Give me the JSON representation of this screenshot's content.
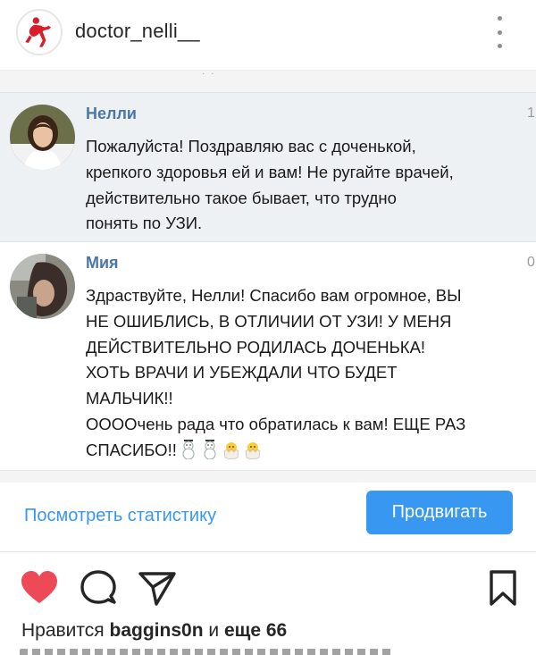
{
  "header": {
    "username": "doctor_nelli__",
    "avatar_icon": "red-figure-logo-icon",
    "more_icon": "more-vertical-icon"
  },
  "screenshot": {
    "comments": [
      {
        "author": "Нелли",
        "text": "Пожалуйста! Поздравляю вас с доченькой,\nкрепкого здоровья ей и вам! Не ругайте врачей,\nдействительно такое бывает, что трудно\nпонять по УЗИ.",
        "side": "1"
      },
      {
        "author": "Мия",
        "text": "Здраствуйте, Нелли! Спасибо вам огромное, ВЫ\nНЕ ОШИБЛИСЬ, В ОТЛИЧИИ ОТ УЗИ! У МЕНЯ\nДЕЙСТВИТЕЛЬНО РОДИЛАСЬ ДОЧЕНЬКА!\nХОТЬ ВРАЧИ И УБЕЖДАЛИ ЧТО БУДЕТ\nМАЛЬЧИК!!\nООООчень рада что обратилась к вам! ЕЩЕ РАЗ\nСПАСИБО!!",
        "emojis": [
          "snowman-icon",
          "snowman-icon",
          "hatching-chick-icon",
          "hatching-chick-icon"
        ],
        "side": "0"
      }
    ]
  },
  "promo": {
    "stats_label": "Посмотреть статистику",
    "promote_label": "Продвигать"
  },
  "actions": {
    "like_icon": "heart-filled-icon",
    "comment_icon": "comment-bubble-icon",
    "share_icon": "paper-plane-icon",
    "save_icon": "bookmark-icon"
  },
  "likes": {
    "prefix": "Нравится",
    "user": "baggins0n",
    "middle": "и",
    "others": "еще 66"
  },
  "colors": {
    "accent": "#3897f0",
    "like_red": "#ed4956",
    "name_blue": "#4a76a8"
  }
}
